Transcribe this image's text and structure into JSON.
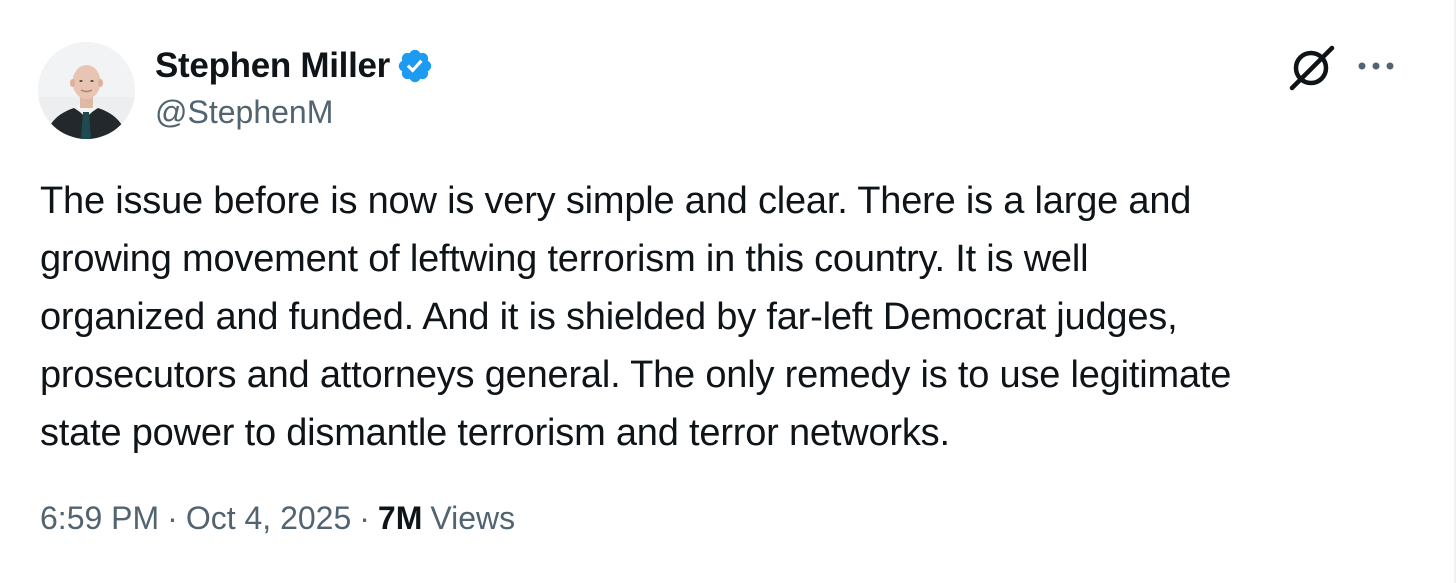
{
  "author": {
    "name": "Stephen Miller",
    "handle": "@StephenM",
    "verified": true,
    "verified_color": "#1d9bf0"
  },
  "icons": {
    "avatar": "profile-photo",
    "verified": "verified-badge-icon",
    "grok": "grok-icon",
    "more": "more-options-icon"
  },
  "tweet": {
    "text": "The issue before is now is very simple and clear. There is a large and\ngrowing movement of leftwing terrorism in this country. It is well\norganized and funded. And it is shielded by far-left Democrat judges,\nprosecutors and attorneys general. The only remedy is to use legitimate\nstate power to dismantle terrorism and terror networks."
  },
  "meta": {
    "time": "6:59 PM",
    "separator": "·",
    "date": "Oct 4, 2025",
    "views_count": "7M",
    "views_label": "Views"
  },
  "colors": {
    "text_primary": "#0f1419",
    "text_secondary": "#536471",
    "background": "#ffffff"
  }
}
